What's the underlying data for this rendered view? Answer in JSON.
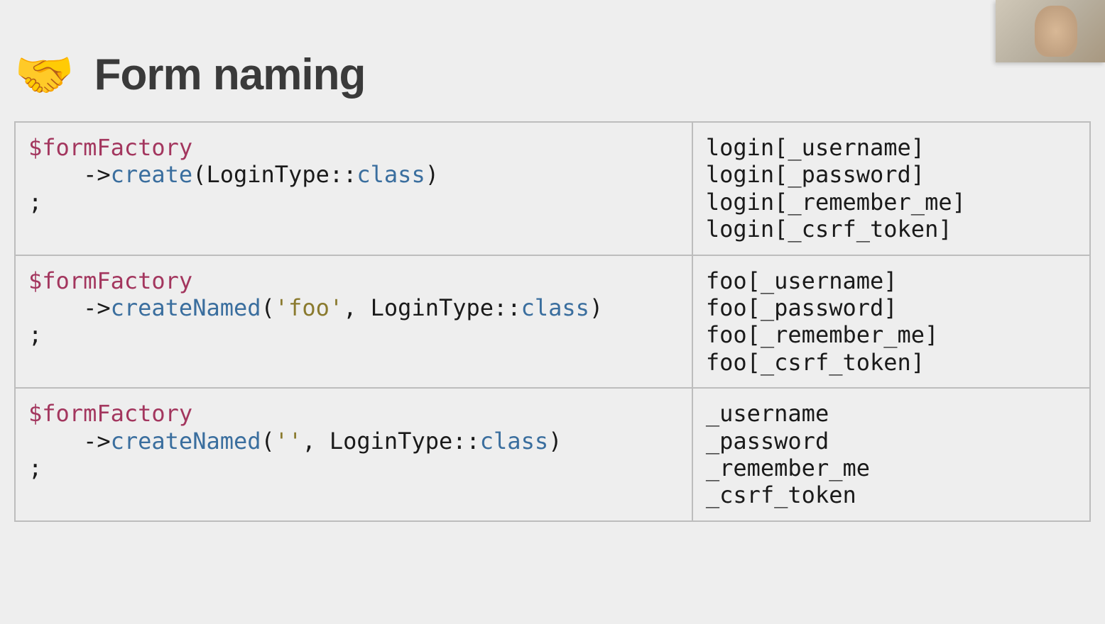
{
  "header": {
    "icon": "🤝",
    "title": "Form naming"
  },
  "rows": [
    {
      "code": {
        "var": "$formFactory",
        "arrow": "->",
        "method": "create",
        "openParen": "(",
        "typeClass": "LoginType::",
        "classKeyword": "class",
        "closeParen": ")",
        "terminator": ";"
      },
      "output": [
        "login[_username]",
        "login[_password]",
        "login[_remember_me]",
        "login[_csrf_token]"
      ]
    },
    {
      "code": {
        "var": "$formFactory",
        "arrow": "->",
        "method": "createNamed",
        "openParen": "(",
        "string": "'foo'",
        "comma": ", ",
        "typeClass": "LoginType::",
        "classKeyword": "class",
        "closeParen": ")",
        "terminator": ";"
      },
      "output": [
        "foo[_username]",
        "foo[_password]",
        "foo[_remember_me]",
        "foo[_csrf_token]"
      ]
    },
    {
      "code": {
        "var": "$formFactory",
        "arrow": "->",
        "method": "createNamed",
        "openParen": "(",
        "string": "''",
        "comma": ", ",
        "typeClass": "LoginType::",
        "classKeyword": "class",
        "closeParen": ")",
        "terminator": ";"
      },
      "output": [
        "_username",
        "_password",
        "_remember_me",
        "_csrf_token"
      ]
    }
  ]
}
